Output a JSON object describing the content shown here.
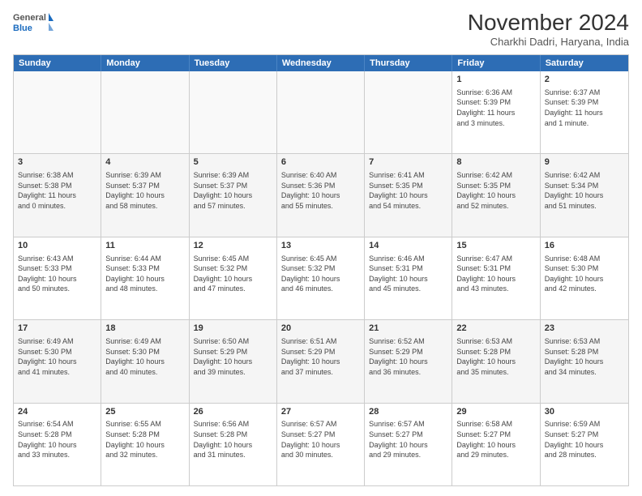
{
  "header": {
    "logo_general": "General",
    "logo_blue": "Blue",
    "month_title": "November 2024",
    "subtitle": "Charkhi Dadri, Haryana, India"
  },
  "calendar": {
    "days_of_week": [
      "Sunday",
      "Monday",
      "Tuesday",
      "Wednesday",
      "Thursday",
      "Friday",
      "Saturday"
    ],
    "rows": [
      [
        {
          "day": "",
          "info": ""
        },
        {
          "day": "",
          "info": ""
        },
        {
          "day": "",
          "info": ""
        },
        {
          "day": "",
          "info": ""
        },
        {
          "day": "",
          "info": ""
        },
        {
          "day": "1",
          "info": "Sunrise: 6:36 AM\nSunset: 5:39 PM\nDaylight: 11 hours\nand 3 minutes."
        },
        {
          "day": "2",
          "info": "Sunrise: 6:37 AM\nSunset: 5:39 PM\nDaylight: 11 hours\nand 1 minute."
        }
      ],
      [
        {
          "day": "3",
          "info": "Sunrise: 6:38 AM\nSunset: 5:38 PM\nDaylight: 11 hours\nand 0 minutes."
        },
        {
          "day": "4",
          "info": "Sunrise: 6:39 AM\nSunset: 5:37 PM\nDaylight: 10 hours\nand 58 minutes."
        },
        {
          "day": "5",
          "info": "Sunrise: 6:39 AM\nSunset: 5:37 PM\nDaylight: 10 hours\nand 57 minutes."
        },
        {
          "day": "6",
          "info": "Sunrise: 6:40 AM\nSunset: 5:36 PM\nDaylight: 10 hours\nand 55 minutes."
        },
        {
          "day": "7",
          "info": "Sunrise: 6:41 AM\nSunset: 5:35 PM\nDaylight: 10 hours\nand 54 minutes."
        },
        {
          "day": "8",
          "info": "Sunrise: 6:42 AM\nSunset: 5:35 PM\nDaylight: 10 hours\nand 52 minutes."
        },
        {
          "day": "9",
          "info": "Sunrise: 6:42 AM\nSunset: 5:34 PM\nDaylight: 10 hours\nand 51 minutes."
        }
      ],
      [
        {
          "day": "10",
          "info": "Sunrise: 6:43 AM\nSunset: 5:33 PM\nDaylight: 10 hours\nand 50 minutes."
        },
        {
          "day": "11",
          "info": "Sunrise: 6:44 AM\nSunset: 5:33 PM\nDaylight: 10 hours\nand 48 minutes."
        },
        {
          "day": "12",
          "info": "Sunrise: 6:45 AM\nSunset: 5:32 PM\nDaylight: 10 hours\nand 47 minutes."
        },
        {
          "day": "13",
          "info": "Sunrise: 6:45 AM\nSunset: 5:32 PM\nDaylight: 10 hours\nand 46 minutes."
        },
        {
          "day": "14",
          "info": "Sunrise: 6:46 AM\nSunset: 5:31 PM\nDaylight: 10 hours\nand 45 minutes."
        },
        {
          "day": "15",
          "info": "Sunrise: 6:47 AM\nSunset: 5:31 PM\nDaylight: 10 hours\nand 43 minutes."
        },
        {
          "day": "16",
          "info": "Sunrise: 6:48 AM\nSunset: 5:30 PM\nDaylight: 10 hours\nand 42 minutes."
        }
      ],
      [
        {
          "day": "17",
          "info": "Sunrise: 6:49 AM\nSunset: 5:30 PM\nDaylight: 10 hours\nand 41 minutes."
        },
        {
          "day": "18",
          "info": "Sunrise: 6:49 AM\nSunset: 5:30 PM\nDaylight: 10 hours\nand 40 minutes."
        },
        {
          "day": "19",
          "info": "Sunrise: 6:50 AM\nSunset: 5:29 PM\nDaylight: 10 hours\nand 39 minutes."
        },
        {
          "day": "20",
          "info": "Sunrise: 6:51 AM\nSunset: 5:29 PM\nDaylight: 10 hours\nand 37 minutes."
        },
        {
          "day": "21",
          "info": "Sunrise: 6:52 AM\nSunset: 5:29 PM\nDaylight: 10 hours\nand 36 minutes."
        },
        {
          "day": "22",
          "info": "Sunrise: 6:53 AM\nSunset: 5:28 PM\nDaylight: 10 hours\nand 35 minutes."
        },
        {
          "day": "23",
          "info": "Sunrise: 6:53 AM\nSunset: 5:28 PM\nDaylight: 10 hours\nand 34 minutes."
        }
      ],
      [
        {
          "day": "24",
          "info": "Sunrise: 6:54 AM\nSunset: 5:28 PM\nDaylight: 10 hours\nand 33 minutes."
        },
        {
          "day": "25",
          "info": "Sunrise: 6:55 AM\nSunset: 5:28 PM\nDaylight: 10 hours\nand 32 minutes."
        },
        {
          "day": "26",
          "info": "Sunrise: 6:56 AM\nSunset: 5:28 PM\nDaylight: 10 hours\nand 31 minutes."
        },
        {
          "day": "27",
          "info": "Sunrise: 6:57 AM\nSunset: 5:27 PM\nDaylight: 10 hours\nand 30 minutes."
        },
        {
          "day": "28",
          "info": "Sunrise: 6:57 AM\nSunset: 5:27 PM\nDaylight: 10 hours\nand 29 minutes."
        },
        {
          "day": "29",
          "info": "Sunrise: 6:58 AM\nSunset: 5:27 PM\nDaylight: 10 hours\nand 29 minutes."
        },
        {
          "day": "30",
          "info": "Sunrise: 6:59 AM\nSunset: 5:27 PM\nDaylight: 10 hours\nand 28 minutes."
        }
      ]
    ]
  }
}
